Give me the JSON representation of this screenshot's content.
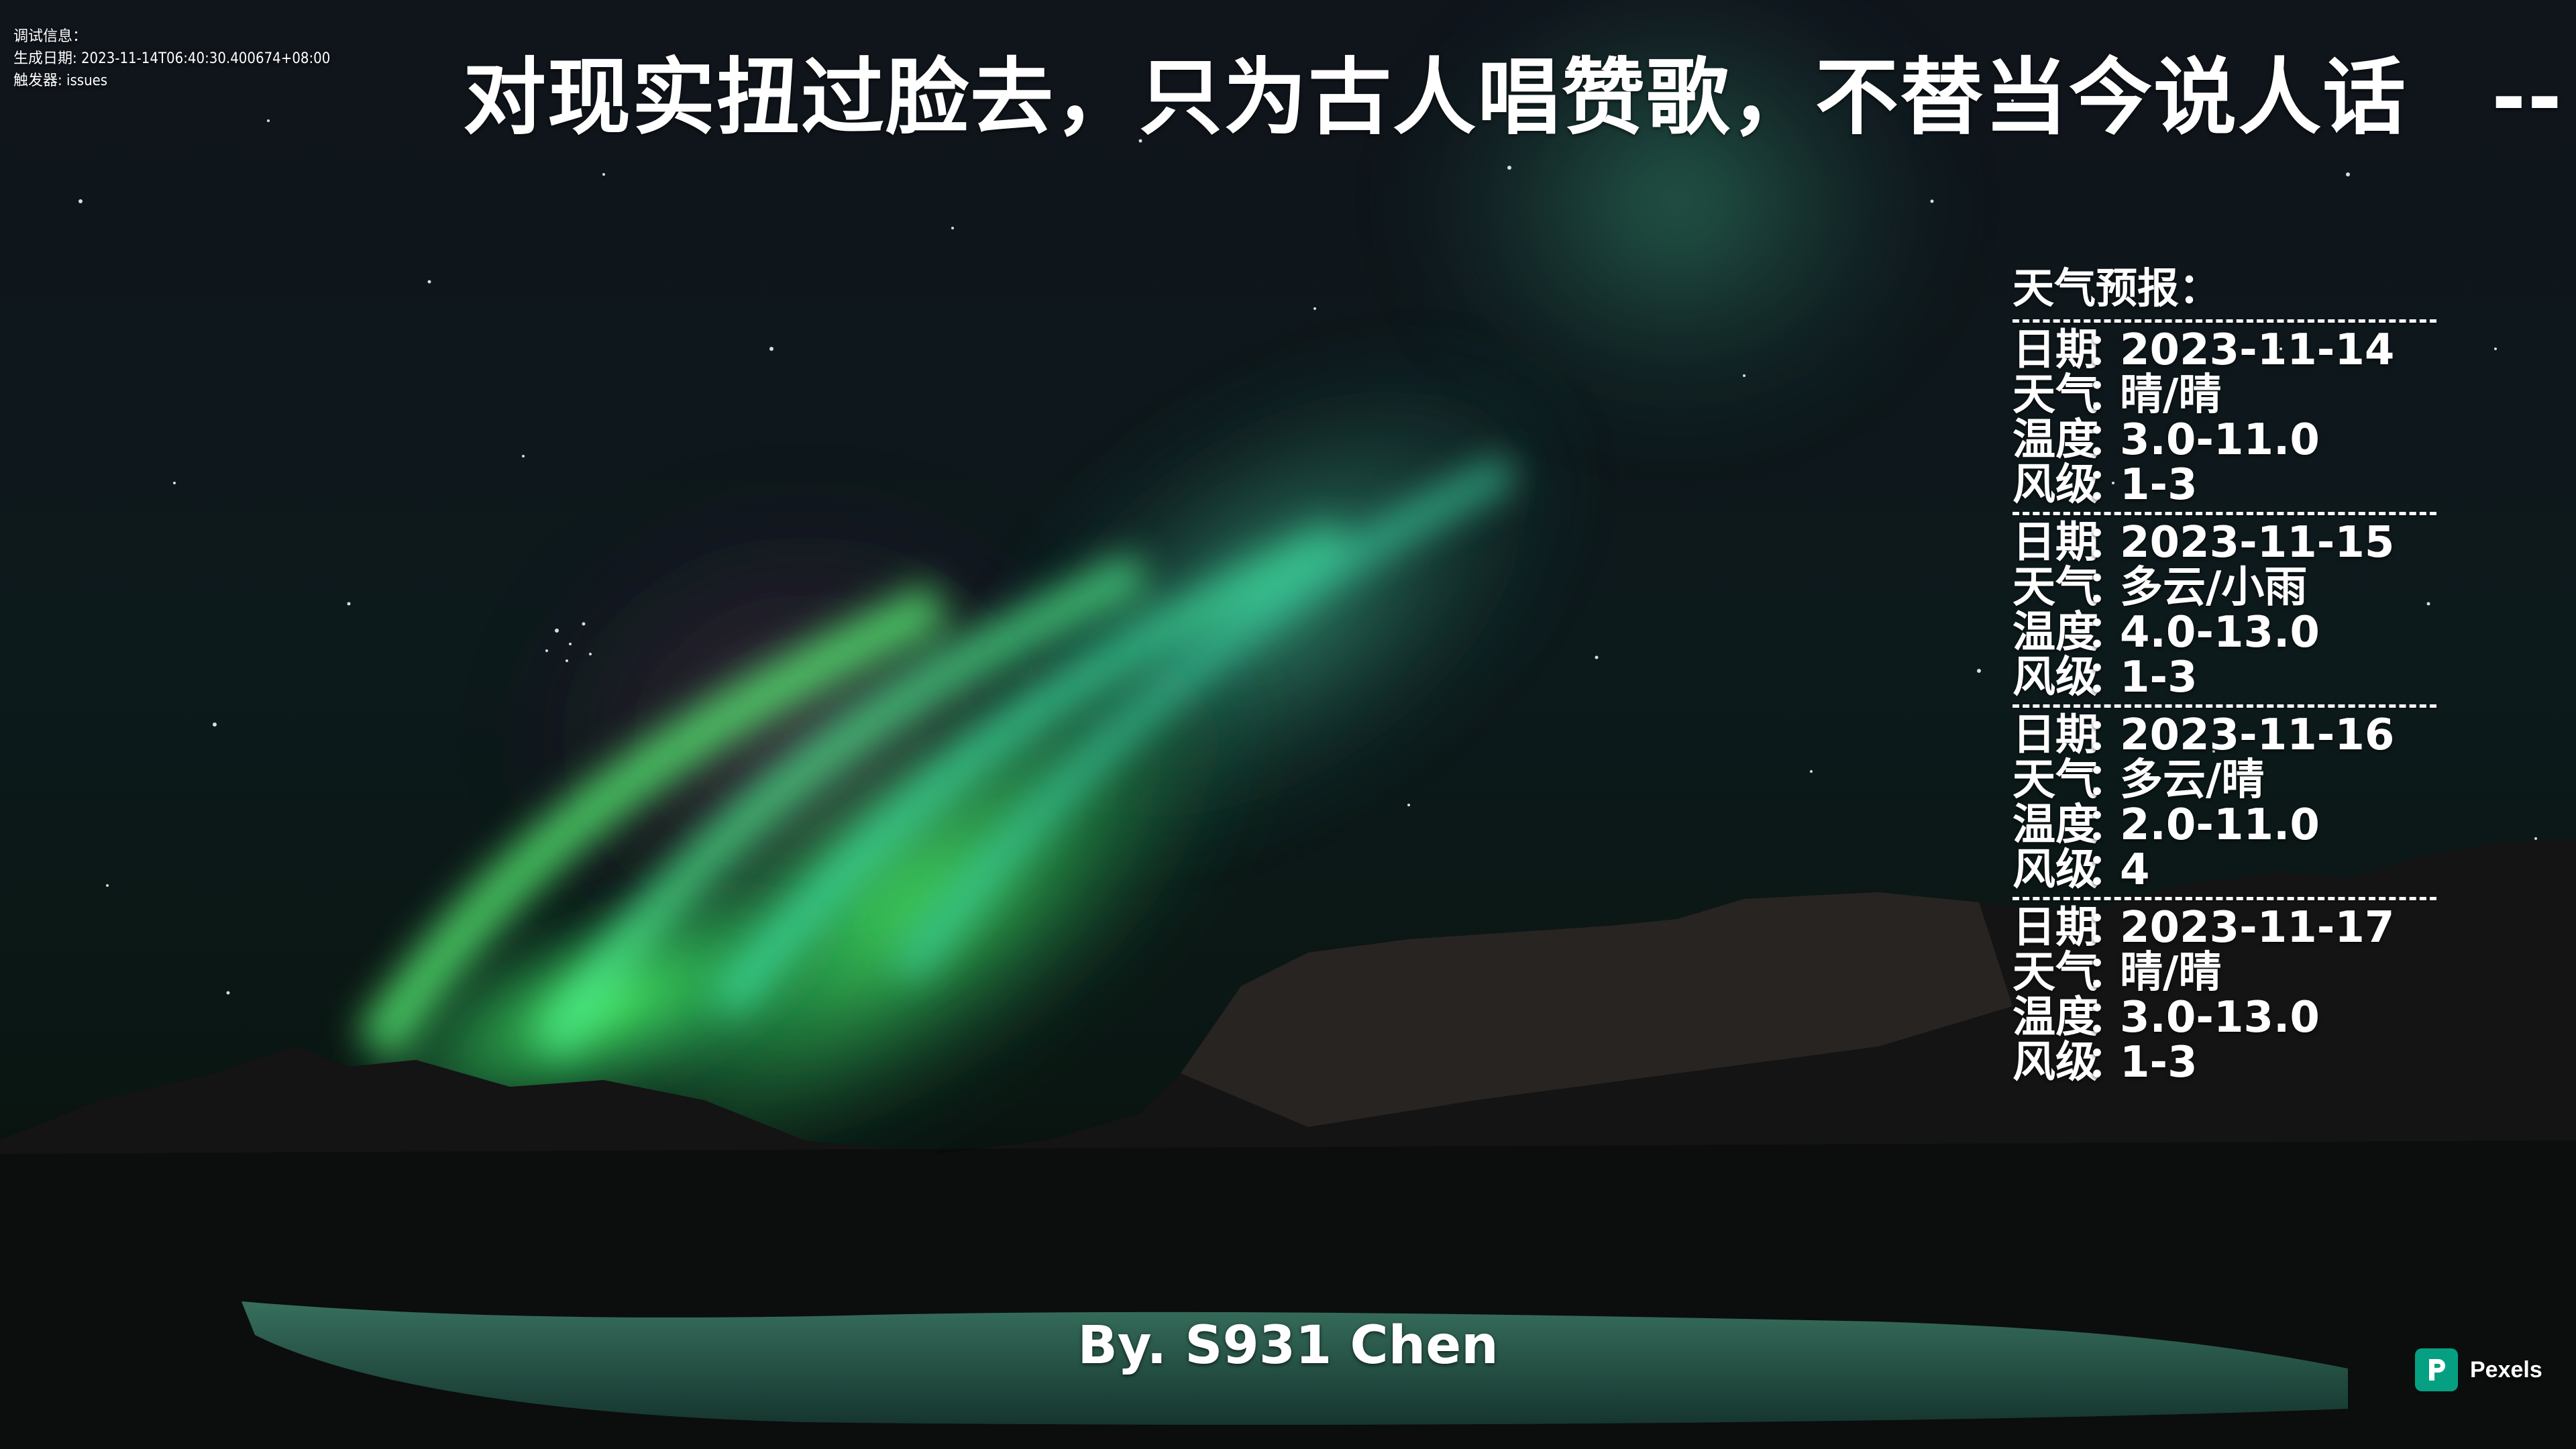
{
  "debug": {
    "line1": "调试信息：",
    "line2": "生成日期: 2023-11-14T06:40:30.400674+08:00",
    "line3": "触发器: issues"
  },
  "quote": {
    "text": "对现实扭过脸去，只为古人唱赞歌，不替当今说人话　--"
  },
  "weather": {
    "title": "天气预报：",
    "separator": "------------------------------",
    "labels": {
      "date": "日期",
      "weather": "天气",
      "temp": "温度",
      "wind": "风级",
      "colon": "："
    },
    "days": [
      {
        "date": "2023-11-14",
        "weather": "晴/晴",
        "temp": "3.0-11.0",
        "wind": "1-3"
      },
      {
        "date": "2023-11-15",
        "weather": "多云/小雨",
        "temp": "4.0-13.0",
        "wind": "1-3"
      },
      {
        "date": "2023-11-16",
        "weather": "多云/晴",
        "temp": "2.0-11.0",
        "wind": "4"
      },
      {
        "date": "2023-11-17",
        "weather": "晴/晴",
        "temp": "3.0-13.0",
        "wind": "1-3"
      }
    ]
  },
  "author": {
    "text": "By. S931 Chen"
  },
  "watermark": {
    "brand": "Pexels",
    "icon": "pexels-logo-icon",
    "color": "#05a081"
  },
  "background": {
    "description_icon": "aurora-wallpaper",
    "aurora_color": "#3fe070",
    "sky_color": "#0a1118"
  }
}
